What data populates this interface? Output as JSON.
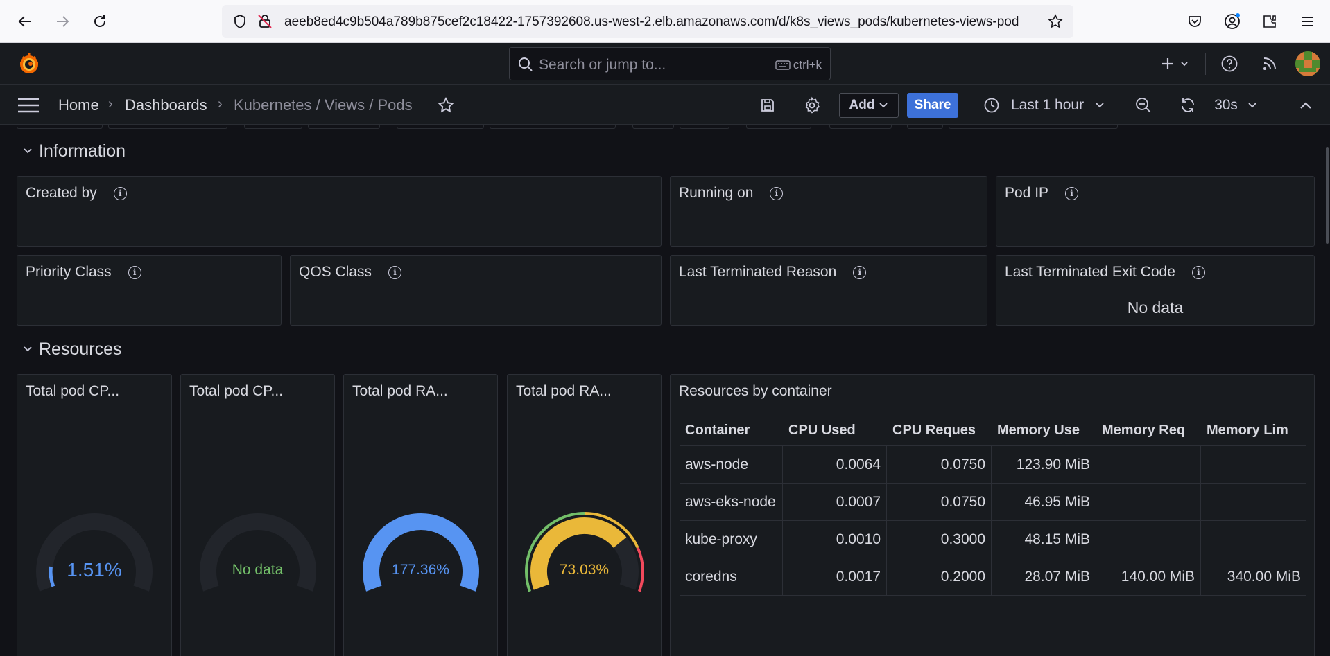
{
  "browser": {
    "url": "aeeb8ed4c9b504a789b875cef2c18422-1757392608.us-west-2.elb.amazonaws.com/d/k8s_views_pods/kubernetes-views-pods"
  },
  "topbar": {
    "search_placeholder": "Search or jump to...",
    "search_shortcut": "ctrl+k"
  },
  "navbar": {
    "crumbs": [
      "Home",
      "Dashboards",
      "Kubernetes / Views / Pods"
    ],
    "add_label": "Add",
    "share_label": "Share",
    "time_range": "Last 1 hour",
    "refresh_interval": "30s"
  },
  "rows": {
    "information": "Information",
    "resources": "Resources"
  },
  "info_panels": {
    "created_by": "Created by",
    "running_on": "Running on",
    "pod_ip": "Pod IP",
    "priority_class": "Priority Class",
    "qos_class": "QOS Class",
    "last_terminated_reason": "Last Terminated Reason",
    "last_terminated_exit_code": "Last Terminated Exit Code",
    "exit_code_value": "No data"
  },
  "gauges": [
    {
      "title": "Total pod CP...",
      "value_text": "1.51%",
      "fraction": 0.0151,
      "color": "#5794f2"
    },
    {
      "title": "Total pod CP...",
      "value_text": "No data",
      "fraction": 0,
      "color": "#73bf69"
    },
    {
      "title": "Total pod RA...",
      "value_text": "177.36%",
      "fraction": 1.0,
      "color": "#5794f2"
    },
    {
      "title": "Total pod RA...",
      "value_text": "73.03%",
      "fraction": 0.7303,
      "color": "#eab839"
    }
  ],
  "table": {
    "title": "Resources by container",
    "columns": [
      "Container",
      "CPU Used",
      "CPU Reques",
      "Memory Use",
      "Memory Req",
      "Memory Lim"
    ],
    "rows": [
      [
        "aws-node",
        "0.0064",
        "0.0750",
        "123.90 MiB",
        "",
        ""
      ],
      [
        "aws-eks-node",
        "0.0007",
        "0.0750",
        "46.95 MiB",
        "",
        ""
      ],
      [
        "kube-proxy",
        "0.0010",
        "0.3000",
        "48.15 MiB",
        "",
        ""
      ],
      [
        "coredns",
        "0.0017",
        "0.2000",
        "28.07 MiB",
        "140.00 MiB",
        "340.00 MiB"
      ]
    ]
  },
  "colors": {
    "accent_blue": "#3d71d9",
    "gauge_track": "#22252b",
    "threshold_green": "#73bf69",
    "threshold_yellow": "#eab839",
    "threshold_red": "#f2495c"
  }
}
